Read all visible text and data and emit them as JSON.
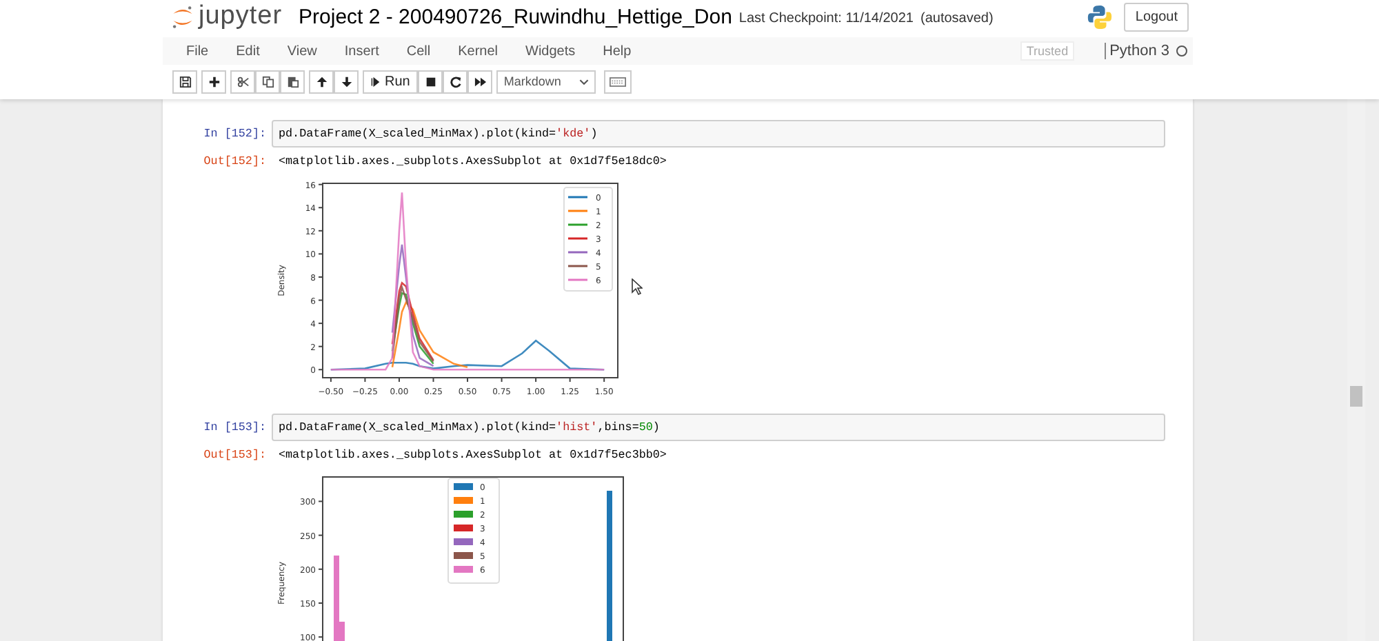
{
  "header": {
    "logo_text": "jupyter",
    "notebook_title": "Project 2 - 200490726_Ruwindhu_Hettige_Don",
    "checkpoint": "Last Checkpoint: 11/14/2021",
    "save_status": "(autosaved)",
    "logout": "Logout"
  },
  "menu": [
    "File",
    "Edit",
    "View",
    "Insert",
    "Cell",
    "Kernel",
    "Widgets",
    "Help"
  ],
  "kernel_indicator": {
    "trusted": "Trusted",
    "kernel": "Python 3",
    "busy": false
  },
  "toolbar": {
    "run": "Run",
    "cell_type": "Markdown"
  },
  "cells": [
    {
      "in_prompt": "In [152]:",
      "code": [
        {
          "kind": "plain",
          "text": "pd.DataFrame(X_scaled_MinMax).plot(kind="
        },
        {
          "kind": "string",
          "text": "'kde'"
        },
        {
          "kind": "plain",
          "text": ")"
        }
      ],
      "out_prompt": "Out[152]:",
      "output": "<matplotlib.axes._subplots.AxesSubplot at 0x1d7f5e18dc0>",
      "chart_data": {
        "type": "line",
        "ylabel": "Density",
        "x": [
          -0.5,
          -0.25,
          -0.1,
          -0.05,
          0,
          0.02,
          0.05,
          0.1,
          0.15,
          0.25,
          0.4,
          0.5,
          0.75,
          0.9,
          1.0,
          1.1,
          1.25,
          1.5
        ],
        "series": [
          {
            "name": "0",
            "color": "#1f77b4",
            "values": [
              0,
              0.1,
              0.5,
              0.6,
              0.6,
              0.6,
              0.6,
              0.5,
              0.3,
              0.1,
              0.3,
              0.4,
              0.3,
              1.4,
              2.5,
              1.6,
              0.1,
              0
            ]
          },
          {
            "name": "1",
            "color": "#ff7f0e",
            "values": [
              null,
              null,
              null,
              0.2,
              3.5,
              5.0,
              5.8,
              5.2,
              3.4,
              1.5,
              0.5,
              0.2,
              null,
              null,
              null,
              null,
              null,
              null
            ]
          },
          {
            "name": "2",
            "color": "#2ca02c",
            "values": [
              null,
              null,
              null,
              1.6,
              5.5,
              6.6,
              6.5,
              4.0,
              2.0,
              0.5,
              null,
              null,
              null,
              null,
              null,
              null,
              null,
              null
            ]
          },
          {
            "name": "3",
            "color": "#d62728",
            "values": [
              null,
              null,
              null,
              2.2,
              6.8,
              7.5,
              7.2,
              4.8,
              2.7,
              0.8,
              null,
              null,
              null,
              null,
              null,
              null,
              null,
              null
            ]
          },
          {
            "name": "4",
            "color": "#9467bd",
            "values": [
              null,
              null,
              null,
              3.2,
              9,
              10.8,
              8,
              3,
              1,
              0.3,
              null,
              null,
              null,
              null,
              null,
              null,
              null,
              null
            ]
          },
          {
            "name": "5",
            "color": "#8c564b",
            "values": [
              null,
              null,
              null,
              1.0,
              6.2,
              7.1,
              6.1,
              4.4,
              2.4,
              0.7,
              null,
              null,
              null,
              null,
              null,
              null,
              null,
              null
            ]
          },
          {
            "name": "6",
            "color": "#e377c2",
            "values": [
              0,
              0,
              0,
              1,
              12,
              15.3,
              9,
              1.5,
              0.3,
              0,
              0,
              0,
              0,
              0,
              0,
              0,
              0,
              0
            ]
          }
        ],
        "legend": true,
        "xlim": [
          -0.56,
          1.6
        ],
        "ylim": [
          -0.7,
          16.1
        ],
        "xticks": [
          {
            "value": -0.5,
            "label": "−0.50"
          },
          {
            "value": -0.25,
            "label": "−0.25"
          },
          {
            "value": 0,
            "label": "0.00"
          },
          {
            "value": 0.25,
            "label": "0.25"
          },
          {
            "value": 0.5,
            "label": "0.50"
          },
          {
            "value": 0.75,
            "label": "0.75"
          },
          {
            "value": 1,
            "label": "1.00"
          },
          {
            "value": 1.25,
            "label": "1.25"
          },
          {
            "value": 1.5,
            "label": "1.50"
          }
        ],
        "yticks": [
          0,
          2,
          4,
          6,
          8,
          10,
          12,
          14,
          16
        ]
      }
    },
    {
      "in_prompt": "In [153]:",
      "code": [
        {
          "kind": "plain",
          "text": "pd.DataFrame(X_scaled_MinMax).plot(kind="
        },
        {
          "kind": "string",
          "text": "'hist'"
        },
        {
          "kind": "plain",
          "text": ",bins="
        },
        {
          "kind": "number",
          "text": "50"
        },
        {
          "kind": "plain",
          "text": ")"
        }
      ],
      "out_prompt": "Out[153]:",
      "output": "<matplotlib.axes._subplots.AxesSubplot at 0x1d7f5ec3bb0>",
      "plot": {
        "ylabel": "Frequency",
        "y_tick_labels": [
          "300",
          "250",
          "200",
          "150",
          "100"
        ],
        "legend": [
          {
            "name": "0",
            "color": "#1f77b4"
          },
          {
            "name": "1",
            "color": "#ff7f0e"
          },
          {
            "name": "2",
            "color": "#2ca02c"
          },
          {
            "name": "3",
            "color": "#d62728"
          },
          {
            "name": "4",
            "color": "#9467bd"
          },
          {
            "name": "5",
            "color": "#8c564b"
          },
          {
            "name": "6",
            "color": "#e377c2"
          }
        ]
      }
    }
  ]
}
